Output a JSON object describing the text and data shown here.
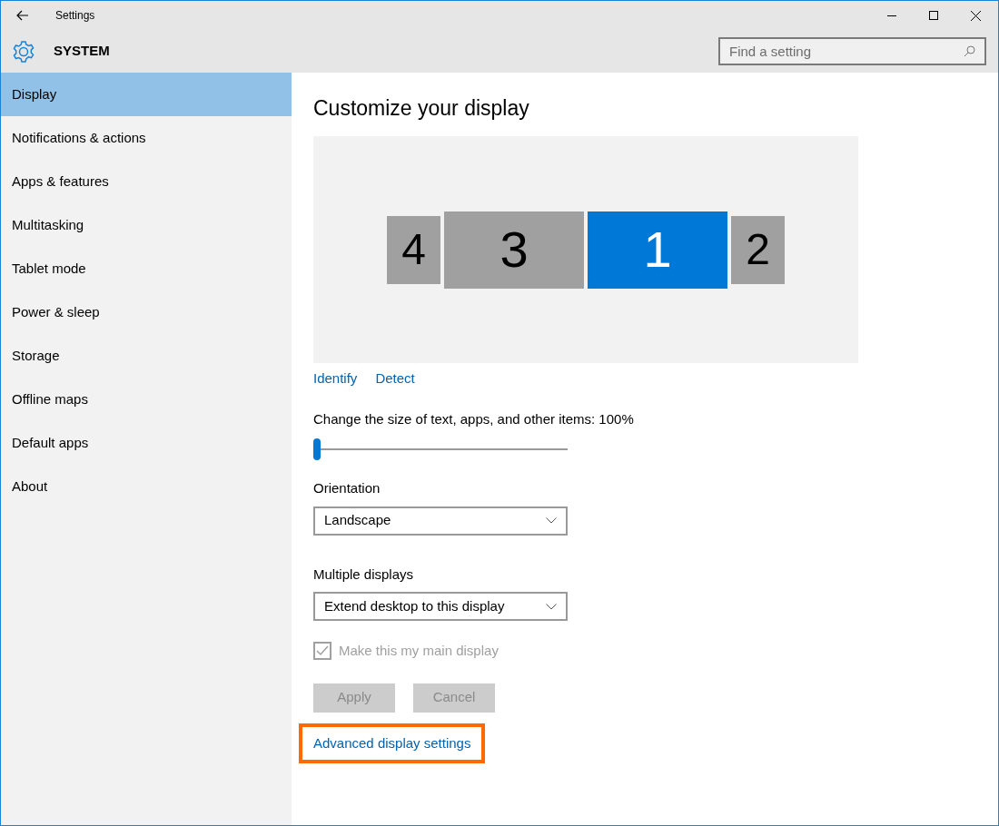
{
  "window": {
    "title": "Settings"
  },
  "header": {
    "title": "SYSTEM",
    "search": {
      "placeholder": "Find a setting"
    }
  },
  "sidebar": {
    "items": [
      {
        "label": "Display",
        "selected": true
      },
      {
        "label": "Notifications & actions",
        "selected": false
      },
      {
        "label": "Apps & features",
        "selected": false
      },
      {
        "label": "Multitasking",
        "selected": false
      },
      {
        "label": "Tablet mode",
        "selected": false
      },
      {
        "label": "Power & sleep",
        "selected": false
      },
      {
        "label": "Storage",
        "selected": false
      },
      {
        "label": "Offline maps",
        "selected": false
      },
      {
        "label": "Default apps",
        "selected": false
      },
      {
        "label": "About",
        "selected": false
      }
    ]
  },
  "content": {
    "title": "Customize your display",
    "monitors": [
      {
        "label": "4",
        "kind": "small",
        "selected": false
      },
      {
        "label": "3",
        "kind": "wide",
        "selected": false
      },
      {
        "label": "1",
        "kind": "wide",
        "selected": true
      },
      {
        "label": "2",
        "kind": "small",
        "selected": false
      }
    ],
    "links": [
      "Identify",
      "Detect"
    ],
    "scale": {
      "label": "Change the size of text, apps, and other items: 100%",
      "level": 0
    },
    "dropdowns": [
      {
        "label": "Orientation",
        "value": "Landscape"
      },
      {
        "label": "Multiple displays",
        "value": "Extend desktop to this display"
      }
    ],
    "main_display": {
      "label": "Make this my main display",
      "checked": true,
      "disabled": true
    },
    "buttons": [
      {
        "label": "Apply",
        "disabled": true
      },
      {
        "label": "Cancel",
        "disabled": true
      }
    ],
    "advanced_link": {
      "label": "Advanced display settings",
      "highlighted": true
    }
  }
}
